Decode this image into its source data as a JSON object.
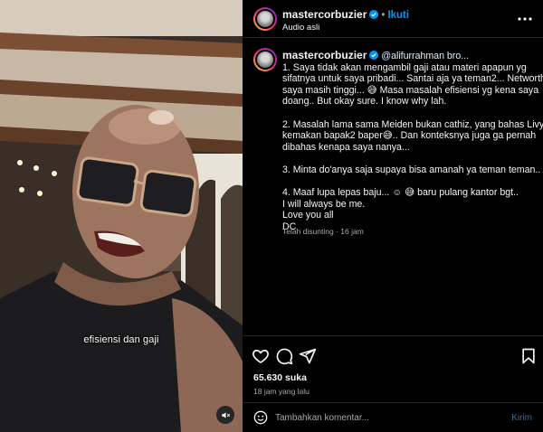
{
  "media": {
    "subtitle": "efisiensi dan gaji",
    "mute_icon": "speaker-muted-icon"
  },
  "header": {
    "username": "mastercorbuzier",
    "separator": "•",
    "follow_label": "Ikuti",
    "audio_label": "Audio asli"
  },
  "caption": {
    "username": "mastercorbuzier",
    "mention": "@alifurrahman bro...",
    "lines": [
      "1. Saya tidak akan mengambil gaji atau materi apapun yg",
      "sifatnya untuk saya pribadi... Santai aja ya teman2... Networth",
      "saya masih tinggi... 😅  Masa masalah efisiensi yg kena saya",
      "doang.. But okay sure. I know why lah.",
      "",
      "2. Masalah lama sama Meiden bukan cathiz, yang bahas Livy. Yg",
      "kemakan bapak2 baper😅.. Dan konteksnya juga ga pernah",
      "dibahas kenapa saya nanya...",
      "",
      "3. Minta do'anya saja supaya bisa amanah ya teman teman.. 🙏",
      "",
      "4. Maaf lupa lepas baju... ☺ 😅  baru pulang kantor bgt..",
      "I will always be me.",
      "Love you all",
      "DC"
    ],
    "meta": "Telah disunting · 16 jam"
  },
  "actions": {
    "likes": "65.630 suka",
    "time_ago": "18 jam yang lalu"
  },
  "comment": {
    "placeholder": "Tambahkan komentar...",
    "send_label": "Kirim"
  },
  "colors": {
    "background": "#000000",
    "accent": "#0095f6",
    "muted_text": "#a8a8a8",
    "divider": "#262626"
  }
}
